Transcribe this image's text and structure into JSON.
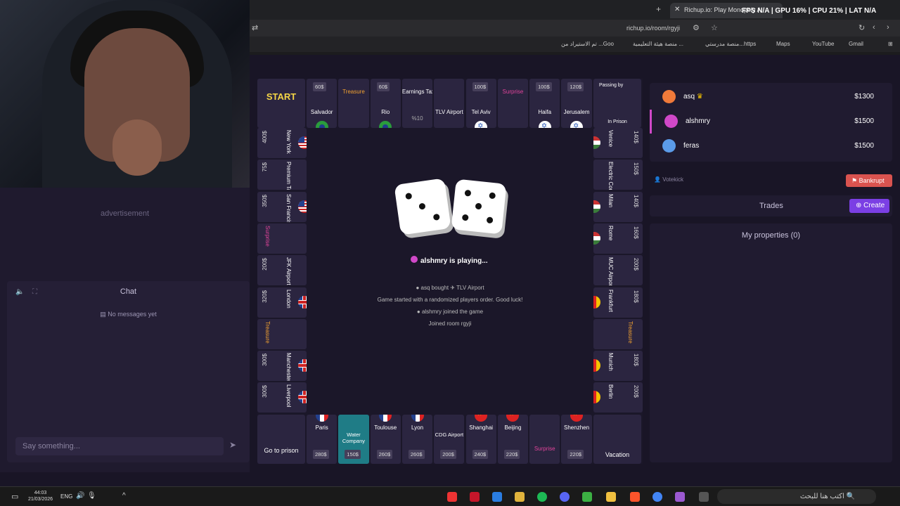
{
  "browser": {
    "tab_title": "Richup.io: Play Monopoly Al",
    "overlay_stats": "FPS N/A | GPU 16% | CPU 21% | LAT N/A",
    "url": "richup.io/room/rgyji",
    "bookmarks": [
      "Gmail",
      "YouTube",
      "Maps",
      "منصة مدرستي...https",
      "منصة هيئة التعليمية ...",
      "تم الاستيراد من ...Goo"
    ]
  },
  "left": {
    "advertisement": "advertisement",
    "chat_title": "Chat",
    "chat_empty": "No messages yet",
    "chat_placeholder": "Say something..."
  },
  "board": {
    "top": [
      {
        "name": "START",
        "price": "",
        "flag": ""
      },
      {
        "name": "Salvador",
        "price": "60$",
        "flag": "br"
      },
      {
        "name": "Treasure",
        "price": "",
        "flag": ""
      },
      {
        "name": "Rio",
        "price": "60$",
        "flag": "br"
      },
      {
        "name": "Earnings Tax",
        "price": "",
        "sub": "%10",
        "flag": ""
      },
      {
        "name": "TLV Airport",
        "price": "",
        "flag": ""
      },
      {
        "name": "Tel Aviv",
        "price": "100$",
        "flag": "il"
      },
      {
        "name": "Surprise",
        "price": "",
        "flag": ""
      },
      {
        "name": "Haifa",
        "price": "100$",
        "flag": "il"
      },
      {
        "name": "Jerusalem",
        "price": "120$",
        "flag": "il"
      },
      {
        "name": "In Prison",
        "top": "Passing by",
        "flag": ""
      }
    ],
    "left": [
      {
        "name": "New York",
        "price": "400$",
        "flag": "us"
      },
      {
        "name": "Premium Tax",
        "price": "75$",
        "flag": ""
      },
      {
        "name": "San Francisco",
        "price": "350$",
        "flag": "us"
      },
      {
        "name": "Surprise",
        "price": "",
        "flag": ""
      },
      {
        "name": "JFK Airport",
        "price": "200$",
        "flag": ""
      },
      {
        "name": "London",
        "price": "320$",
        "flag": "gb"
      },
      {
        "name": "Treasure",
        "price": "",
        "flag": ""
      },
      {
        "name": "Manchester",
        "price": "300$",
        "flag": "gb"
      },
      {
        "name": "Liverpool",
        "price": "300$",
        "flag": "gb"
      }
    ],
    "right": [
      {
        "name": "Venice",
        "price": "140$",
        "flag": "hu"
      },
      {
        "name": "Electric Company",
        "price": "150$",
        "flag": ""
      },
      {
        "name": "Milan",
        "price": "140$",
        "flag": "hu"
      },
      {
        "name": "Rome",
        "price": "160$",
        "flag": "hu"
      },
      {
        "name": "MUC Airport",
        "price": "200$",
        "flag": ""
      },
      {
        "name": "Frankfurt",
        "price": "180$",
        "flag": "de"
      },
      {
        "name": "Treasure",
        "price": "",
        "flag": ""
      },
      {
        "name": "Munich",
        "price": "180$",
        "flag": "de"
      },
      {
        "name": "Berlin",
        "price": "200$",
        "flag": "de"
      }
    ],
    "bottom": [
      {
        "name": "Go to prison",
        "price": "",
        "flag": ""
      },
      {
        "name": "Paris",
        "price": "280$",
        "flag": "fr"
      },
      {
        "name": "Water Company",
        "price": "150$",
        "flag": ""
      },
      {
        "name": "Toulouse",
        "price": "260$",
        "flag": "fr"
      },
      {
        "name": "Lyon",
        "price": "260$",
        "flag": "fr"
      },
      {
        "name": "CDG Airport",
        "price": "200$",
        "flag": ""
      },
      {
        "name": "Shanghai",
        "price": "240$",
        "flag": "cn"
      },
      {
        "name": "Beijing",
        "price": "220$",
        "flag": "cn"
      },
      {
        "name": "Surprise",
        "price": "",
        "flag": ""
      },
      {
        "name": "Shenzhen",
        "price": "220$",
        "flag": "cn"
      },
      {
        "name": "Vacation",
        "price": "",
        "flag": ""
      }
    ],
    "status": "alshmry  is playing...",
    "log": [
      {
        "who": "asq",
        "action": "bought",
        "what": "TLV Airport"
      },
      {
        "text": "Game started with a randomized players order. Good luck!"
      },
      {
        "who": "alshmry",
        "action": "joined the game"
      },
      {
        "text": "Joined room rgyji"
      }
    ]
  },
  "players": [
    {
      "name": "asq",
      "money": "$1300",
      "color": "#f07a3a",
      "crown": true
    },
    {
      "name": "alshmry",
      "money": "$1500",
      "color": "#d048c8",
      "crown": false
    },
    {
      "name": "feras",
      "money": "$1500",
      "color": "#5b9be8",
      "crown": false
    }
  ],
  "actions": {
    "votekick": "Votekick",
    "bankrupt": "Bankrupt",
    "trades": "Trades",
    "create": "Create",
    "my_properties": "My properties (0)"
  },
  "taskbar": {
    "time": "44:03",
    "date": "21/03/2026",
    "lang": "ENG",
    "search": "اكتب هنا للبحث"
  }
}
